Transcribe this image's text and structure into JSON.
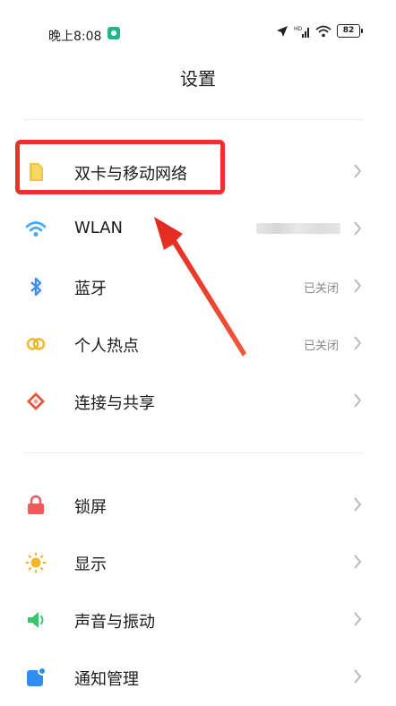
{
  "status_bar": {
    "time": "晚上8:08",
    "battery": "82"
  },
  "header": {
    "title": "设置"
  },
  "section1": [
    {
      "label": "双卡与移动网络",
      "value": "",
      "icon": "sim-card-icon",
      "color": "#f4c63a"
    },
    {
      "label": "WLAN",
      "value": "",
      "icon": "wifi-icon",
      "color": "#3fa9f5"
    },
    {
      "label": "蓝牙",
      "value": "已关闭",
      "icon": "bluetooth-icon",
      "color": "#3f8ef5"
    },
    {
      "label": "个人热点",
      "value": "已关闭",
      "icon": "hotspot-icon",
      "color": "#f0b72f"
    },
    {
      "label": "连接与共享",
      "value": "",
      "icon": "share-icon",
      "color": "#e4573d"
    }
  ],
  "section2": [
    {
      "label": "锁屏",
      "icon": "lock-icon",
      "color": "#f05a5a"
    },
    {
      "label": "显示",
      "icon": "sun-icon",
      "color": "#f3b52a"
    },
    {
      "label": "声音与振动",
      "icon": "speaker-icon",
      "color": "#38c56b"
    },
    {
      "label": "通知管理",
      "icon": "notification-icon",
      "color": "#2f8ff0"
    }
  ],
  "annotation": {
    "highlight_color": "#e8322b"
  }
}
